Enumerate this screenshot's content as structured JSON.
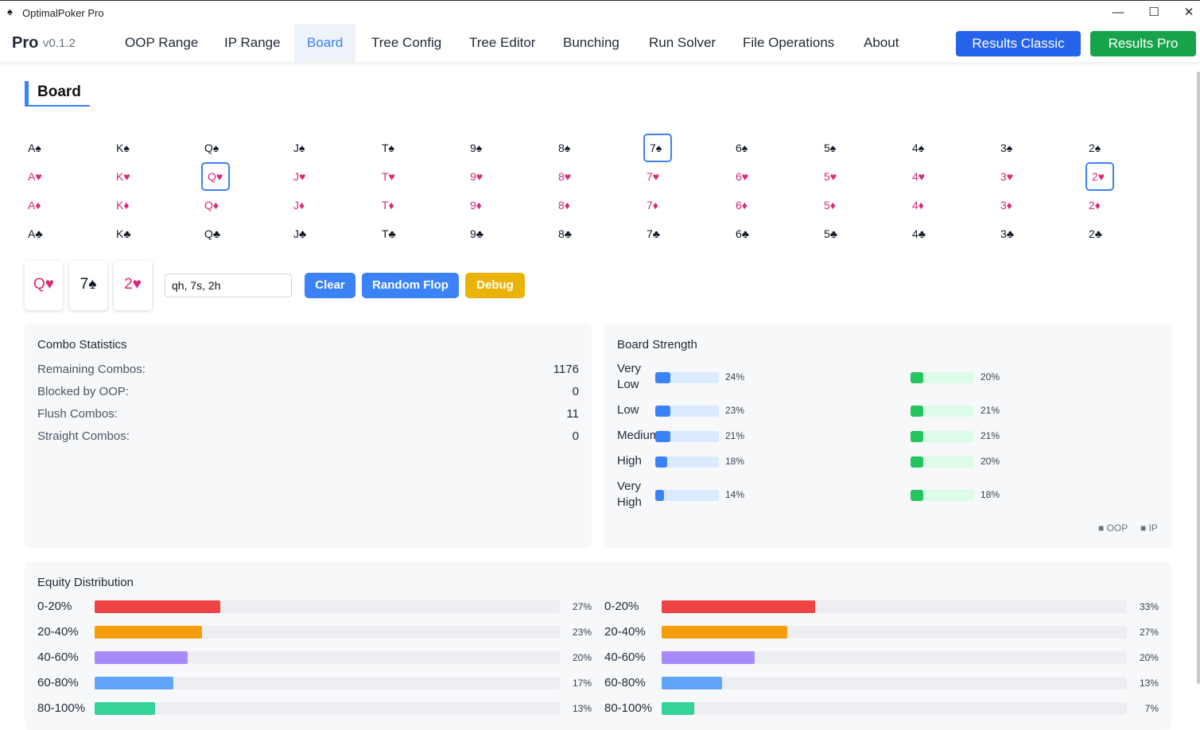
{
  "window": {
    "title": "OptimalPoker Pro",
    "icon": "spade-icon",
    "minimize": "—",
    "maximize": "☐",
    "close": "✕"
  },
  "nav": {
    "brand": "Pro",
    "version": "v0.1.2",
    "tabs": [
      "OOP Range",
      "IP Range",
      "Board",
      "Tree Config",
      "Tree Editor",
      "Bunching",
      "Run Solver",
      "File Operations",
      "About"
    ],
    "active_tab": "Board",
    "results_classic": "Results Classic",
    "results_pro": "Results Pro"
  },
  "section_title": "Board",
  "grid": {
    "ranks": [
      "A",
      "K",
      "Q",
      "J",
      "T",
      "9",
      "8",
      "7",
      "6",
      "5",
      "4",
      "3",
      "2"
    ],
    "suits": [
      {
        "symbol": "♠",
        "color": "#111827",
        "code": "s"
      },
      {
        "symbol": "♥",
        "color": "#db2777",
        "code": "h"
      },
      {
        "symbol": "♦",
        "color": "#db2777",
        "code": "d"
      },
      {
        "symbol": "♣",
        "color": "#111827",
        "code": "c"
      }
    ],
    "selected": [
      "7s",
      "Qh",
      "2h"
    ]
  },
  "selected_cards": [
    {
      "label": "Q♥",
      "color": "#db2777"
    },
    {
      "label": "7♠",
      "color": "#111827"
    },
    {
      "label": "2♥",
      "color": "#db2777"
    }
  ],
  "board_input": {
    "value": "qh, 7s, 2h"
  },
  "buttons": {
    "clear": "Clear",
    "random_flop": "Random Flop",
    "debug": "Debug"
  },
  "combo_stats": {
    "title": "Combo Statistics",
    "rows": [
      {
        "label": "Remaining Combos:",
        "value": "1176"
      },
      {
        "label": "Blocked by OOP:",
        "value": "0"
      },
      {
        "label": "Flush Combos:",
        "value": "11"
      },
      {
        "label": "Straight Combos:",
        "value": "0"
      }
    ]
  },
  "board_strength": {
    "title": "Board Strength",
    "rows": [
      {
        "label": "Very Low",
        "oop": 24,
        "ip": 20,
        "oop_text": "24%",
        "ip_text": "20%"
      },
      {
        "label": "Low",
        "oop": 23,
        "ip": 21,
        "oop_text": "23%",
        "ip_text": "21%"
      },
      {
        "label": "Medium",
        "oop": 21,
        "ip": 21,
        "oop_text": "21%",
        "ip_text": "21%"
      },
      {
        "label": "High",
        "oop": 18,
        "ip": 20,
        "oop_text": "18%",
        "ip_text": "20%"
      },
      {
        "label": "Very High",
        "oop": 14,
        "ip": 18,
        "oop_text": "14%",
        "ip_text": "18%"
      }
    ],
    "legend": [
      "■ OOP",
      "■ IP"
    ],
    "colors": {
      "oop": "#3b82f6",
      "ip": "#22c55e"
    }
  },
  "equity": {
    "title": "Equity Distribution",
    "buckets": [
      "0-20%",
      "20-40%",
      "40-60%",
      "60-80%",
      "80-100%"
    ],
    "colors": [
      "#ef4444",
      "#f59e0b",
      "#a78bfa",
      "#60a5fa",
      "#34d399"
    ],
    "oop": [
      27,
      23,
      20,
      17,
      13
    ],
    "ip": [
      33,
      27,
      20,
      13,
      7
    ],
    "oop_text": [
      "27%",
      "23%",
      "20%",
      "17%",
      "13%"
    ],
    "ip_text": [
      "33%",
      "27%",
      "20%",
      "13%",
      "7%"
    ]
  }
}
